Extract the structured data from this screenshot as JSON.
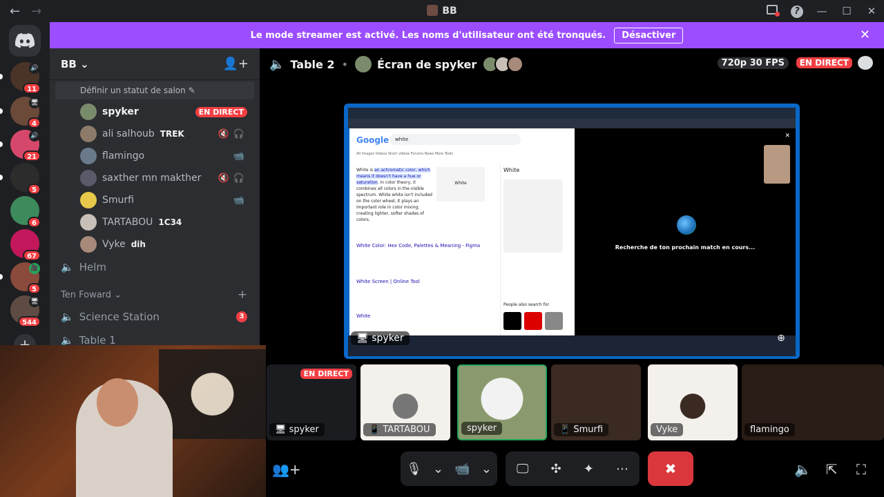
{
  "window": {
    "title": "BB",
    "nav_back": "←",
    "nav_forward": "→"
  },
  "guilds": [
    {
      "badge": "11",
      "voice": "🔊",
      "color": "#4a3428"
    },
    {
      "badge": "4",
      "voice": "🖥",
      "color": "#6b4a3a"
    },
    {
      "badge": "21",
      "voice": "🔊",
      "color": "#d6486b"
    },
    {
      "badge": "5",
      "voice": "",
      "color": "#2c2c2c"
    },
    {
      "badge": "6",
      "voice": "",
      "color": "#3d8a5c"
    },
    {
      "badge": "67",
      "voice": "",
      "color": "#c2185b"
    },
    {
      "badge": "5",
      "voice": "🎥",
      "color": "#8a4b3c"
    },
    {
      "badge": "544",
      "voice": "🖥",
      "color": "#5e4c44"
    }
  ],
  "banner": {
    "message": "Le mode streamer est activé. Les noms d'utilisateur ont été tronqués.",
    "button": "Désactiver"
  },
  "sidebar": {
    "server_name": "BB",
    "status_hint": "Définir un statut de salon",
    "voice_users": [
      {
        "name": "spyker",
        "tag": "",
        "live": "EN DIRECT",
        "color": "#7a8b6b",
        "active": true
      },
      {
        "name": "ali salhoub",
        "tag": "TREK",
        "live": "",
        "color": "#8d7b6a",
        "active": false
      },
      {
        "name": "flamingo",
        "tag": "",
        "live": "",
        "color": "#6a7a8a",
        "active": false
      },
      {
        "name": "saxther mn makther",
        "tag": "",
        "live": "",
        "color": "#5a5a6a",
        "active": false
      },
      {
        "name": "Smurfi",
        "tag": "",
        "live": "",
        "color": "#e8c84a",
        "active": false
      },
      {
        "name": "TARTABOU",
        "tag": "1C34",
        "live": "",
        "color": "#c8c0b8",
        "active": false
      },
      {
        "name": "Vyke",
        "tag": "dih",
        "live": "",
        "color": "#a88a7a",
        "active": false
      }
    ],
    "channels": [
      {
        "name": "Helm",
        "badge": ""
      }
    ],
    "category": "Ten Foward",
    "category_channels": [
      {
        "name": "Science Station",
        "badge": "3"
      },
      {
        "name": "Table 1",
        "badge": ""
      }
    ]
  },
  "stage": {
    "channel": "Table 2",
    "screen_title": "Écran de spyker",
    "quality": "720p 30 FPS",
    "live": "EN DIRECT",
    "screen_label": "spyker",
    "google": {
      "logo": "Google",
      "query": "white",
      "tabs": "All   Images   Videos   Short videos   Forums   News   More   Tools",
      "snippet_pre": "White is ",
      "snippet_hl": "an achromatic color, which means it doesn't have a hue or saturation",
      "snippet_post": ". In color theory, it combines all colors in the visible spectrum. White white isn't included on the color wheel, it plays an important role in color mixing, creating lighter, softer shades of colors.",
      "img_label": "White",
      "link1": "White Color: Hex Code, Palettes & Meaning - Figma",
      "link2": "White Screen | Online Tool",
      "link3": "White",
      "kp_title": "White",
      "people": "People also search for"
    },
    "game": {
      "message": "Recherche de ton prochain match en cours..."
    },
    "tiles": [
      {
        "name": "spyker",
        "live": "EN DIRECT"
      },
      {
        "name": "TARTABOU",
        "live": ""
      },
      {
        "name": "spyker",
        "live": ""
      },
      {
        "name": "Smurfi",
        "live": ""
      },
      {
        "name": "Vyke",
        "live": ""
      },
      {
        "name": "flamingo",
        "live": ""
      }
    ]
  }
}
